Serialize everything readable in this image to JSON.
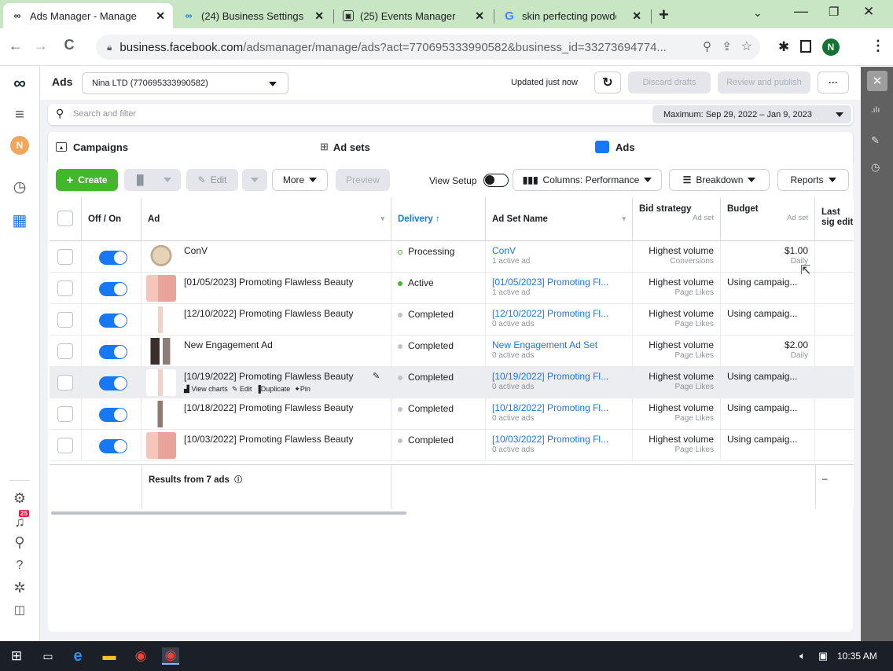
{
  "browser": {
    "tabs": [
      {
        "title": "Ads Manager - Manage",
        "icon": "meta-icon",
        "active": true
      },
      {
        "title": "(24) Business Settings",
        "icon": "meta-icon"
      },
      {
        "title": "(25) Events Manager",
        "icon": "events-icon"
      },
      {
        "title": "skin perfecting powder",
        "icon": "google-icon"
      }
    ],
    "new_tab": "+",
    "url_host": "business.facebook.com",
    "url_path": "/adsmanager/manage/ads?act=770695333990582&business_id=33273694774...",
    "profile_initial": "N"
  },
  "header": {
    "ads_label": "Ads",
    "account": "Nina LTD (770695333990582)",
    "updated": "Updated just now",
    "discard": "Discard drafts",
    "review": "Review and publish",
    "more": "···"
  },
  "search": {
    "placeholder": "Search and filter",
    "date_range": "Maximum: Sep 29, 2022 – Jan 9, 2023"
  },
  "levels": {
    "campaigns": "Campaigns",
    "adsets": "Ad sets",
    "ads": "Ads"
  },
  "toolbar": {
    "create": "Create",
    "edit": "Edit",
    "more": "More",
    "preview": "Preview",
    "view_setup": "View Setup",
    "columns": "Columns: Performance",
    "breakdown": "Breakdown",
    "reports": "Reports"
  },
  "table": {
    "headers": {
      "offon": "Off / On",
      "ad": "Ad",
      "delivery": "Delivery ↑",
      "adset": "Ad Set Name",
      "bid": "Bid strategy",
      "bid_sub": "Ad set",
      "budget": "Budget",
      "budget_sub": "Ad set",
      "last": "Last sig edit"
    },
    "rows": [
      {
        "ad": "ConV",
        "delivery": "Processing",
        "adset": "ConV",
        "adset_sub": "1 active ad",
        "bid": "Highest volume",
        "bid_sub": "Conversions",
        "budget": "$1.00",
        "budget_sub": "Daily"
      },
      {
        "ad": "[01/05/2023] Promoting Flawless Beauty",
        "delivery": "Active",
        "adset": "[01/05/2023] Promoting Fl...",
        "adset_sub": "1 active ad",
        "bid": "Highest volume",
        "bid_sub": "Page Likes",
        "budget": "Using campaig...",
        "budget_sub": ""
      },
      {
        "ad": "[12/10/2022] Promoting Flawless Beauty",
        "delivery": "Completed",
        "adset": "[12/10/2022] Promoting Fl...",
        "adset_sub": "0 active ads",
        "bid": "Highest volume",
        "bid_sub": "Page Likes",
        "budget": "Using campaig...",
        "budget_sub": ""
      },
      {
        "ad": "New Engagement Ad",
        "delivery": "Completed",
        "adset": "New Engagement Ad Set",
        "adset_sub": "0 active ads",
        "bid": "Highest volume",
        "bid_sub": "Page Likes",
        "budget": "$2.00",
        "budget_sub": "Daily"
      },
      {
        "ad": "[10/19/2022] Promoting Flawless Beauty",
        "delivery": "Completed",
        "adset": "[10/19/2022] Promoting Fl...",
        "adset_sub": "0 active ads",
        "bid": "Highest volume",
        "bid_sub": "Page Likes",
        "budget": "Using campaig...",
        "budget_sub": ""
      },
      {
        "ad": "[10/18/2022] Promoting Flawless Beauty",
        "delivery": "Completed",
        "adset": "[10/18/2022] Promoting Fl...",
        "adset_sub": "0 active ads",
        "bid": "Highest volume",
        "bid_sub": "Page Likes",
        "budget": "Using campaig...",
        "budget_sub": ""
      },
      {
        "ad": "[10/03/2022] Promoting Flawless Beauty",
        "delivery": "Completed",
        "adset": "[10/03/2022] Promoting Fl...",
        "adset_sub": "0 active ads",
        "bid": "Highest volume",
        "bid_sub": "Page Likes",
        "budget": "Using campaig...",
        "budget_sub": ""
      }
    ],
    "hover_actions": {
      "charts": "View charts",
      "edit": "Edit",
      "duplicate": "Duplicate",
      "pin": "Pin"
    },
    "results": "Results from 7 ads",
    "results_last": "–"
  },
  "left_rail": {
    "avatar": "N",
    "notif_count": "25"
  },
  "taskbar": {
    "time": "10:35 AM"
  },
  "colors": {
    "accent": "#1877f2",
    "create": "#42b72a",
    "processing": "#42b72a",
    "active": "#42b72a",
    "completed": "#bec3c9"
  }
}
